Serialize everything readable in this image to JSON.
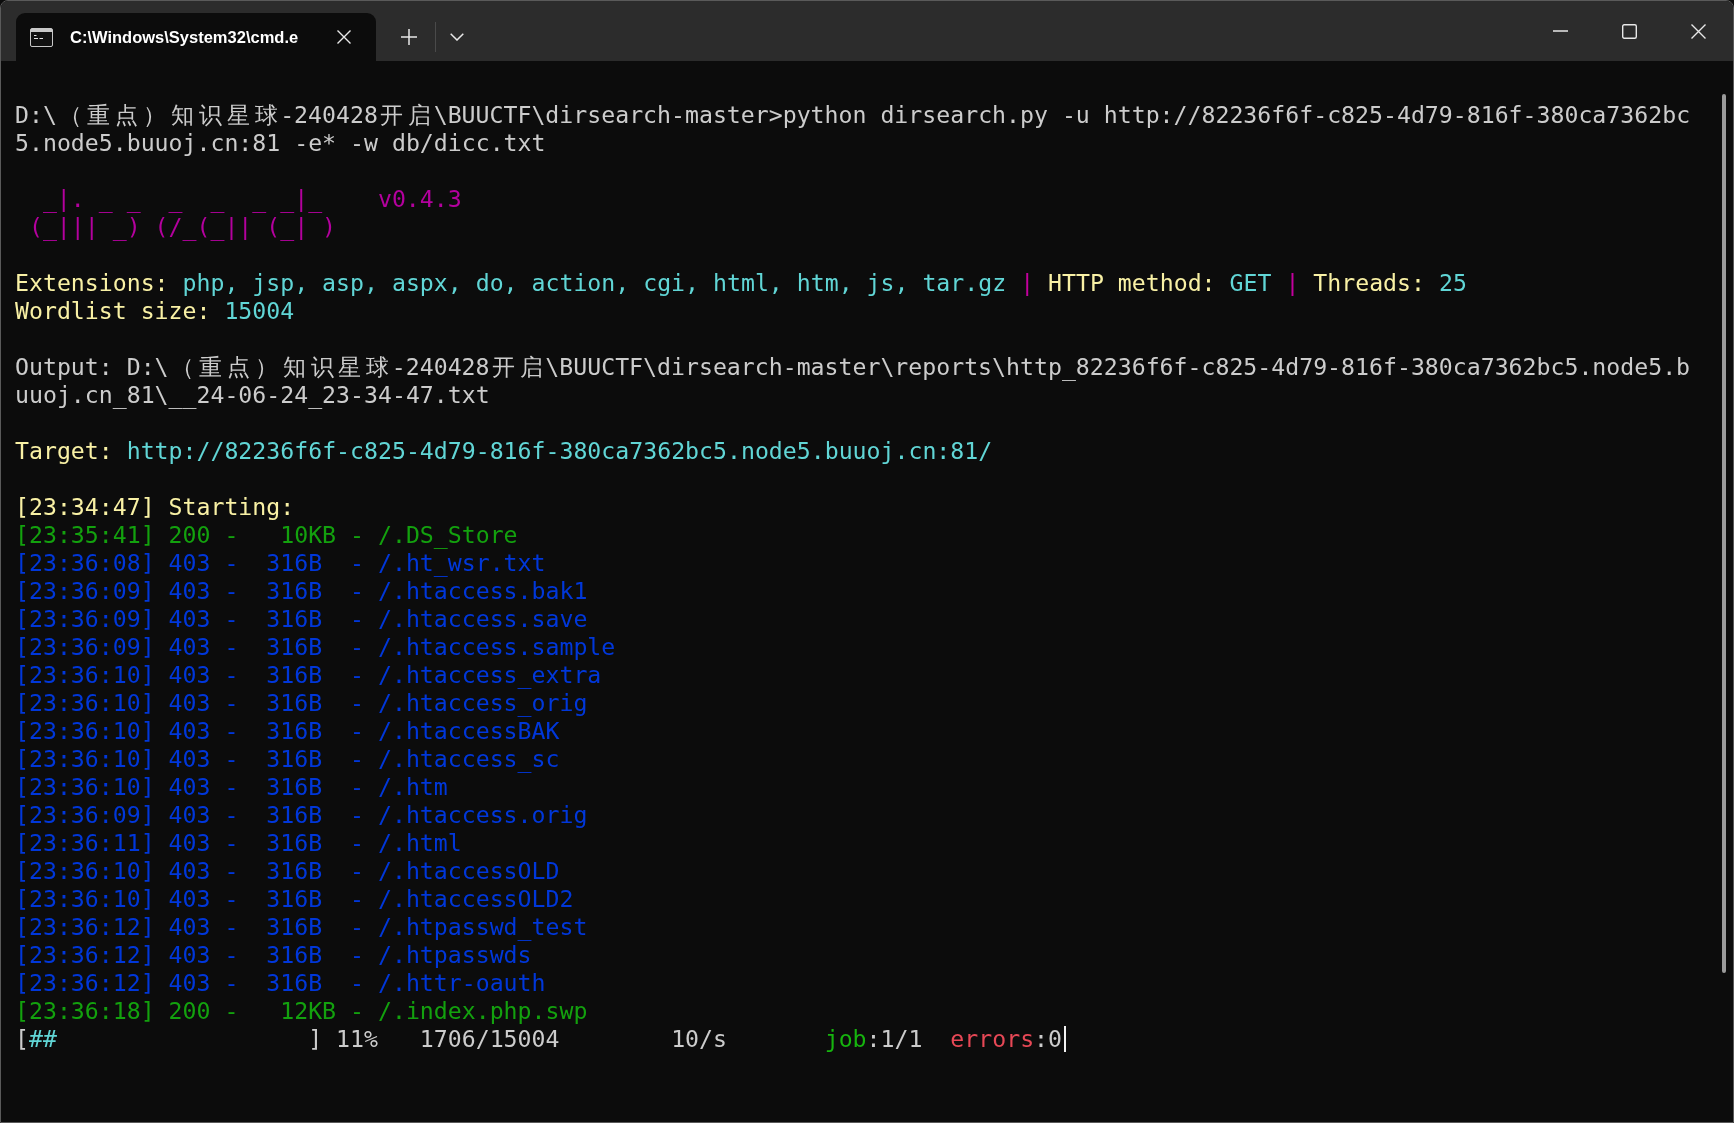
{
  "tabs": [
    {
      "title": "C:\\Windows\\System32\\cmd.e",
      "selected": true
    }
  ],
  "terminal": {
    "sections": [
      {
        "lines": [
          {
            "kind": "text",
            "text": "D:\\（重点）知识星球-240428开启\\BUUCTF\\dirsearch-master>python dirsearch.py -u http://82236f6f-c825-4d79-816f-380ca7362bc"
          },
          {
            "kind": "text",
            "text": "5.node5.buuoj.cn:81 -e* -w db/dicc.txt"
          }
        ]
      },
      {
        "lines": [
          {
            "kind": "banner",
            "art": [
              " _|. _ _  _  _  _ _|_",
              "(_||| _) (/_(_|| (_| )"
            ],
            "version": "v0.4.3"
          }
        ]
      },
      {
        "lines": [
          {
            "kind": "fields",
            "fields": [
              {
                "label": "Extensions:",
                "value": "php, jsp, asp, aspx, do, action, cgi, html, htm, js, tar.gz"
              },
              {
                "separator": "|",
                "label": "HTTP method:",
                "value": "GET"
              },
              {
                "separator": "|",
                "label": "Threads:",
                "value": "25"
              }
            ]
          },
          {
            "kind": "fields",
            "fields": [
              {
                "label": "Wordlist size:",
                "value": "15004"
              }
            ]
          }
        ]
      },
      {
        "lines": [
          {
            "kind": "text",
            "text": "Output: D:\\（重点）知识星球-240428开启\\BUUCTF\\dirsearch-master\\reports\\http_82236f6f-c825-4d79-816f-380ca7362bc5.node5.b"
          },
          {
            "kind": "text",
            "text": "uuoj.cn_81\\__24-06-24_23-34-47.txt"
          }
        ]
      },
      {
        "lines": [
          {
            "kind": "fields",
            "fields": [
              {
                "label": "Target:",
                "value": "http://82236f6f-c825-4d79-816f-380ca7362bc5.node5.buuoj.cn:81/"
              }
            ]
          }
        ]
      },
      {
        "lines": [
          {
            "kind": "status",
            "text": "[23:34:47] Starting:"
          },
          {
            "kind": "log",
            "text": "[23:35:41] 200 -   10KB - /.DS_Store",
            "color": "#13a10e"
          },
          {
            "kind": "log",
            "text": "[23:36:08] 403 -  316B  - /.ht_wsr.txt",
            "color": "#0037da"
          },
          {
            "kind": "log",
            "text": "[23:36:09] 403 -  316B  - /.htaccess.bak1",
            "color": "#0037da"
          },
          {
            "kind": "log",
            "text": "[23:36:09] 403 -  316B  - /.htaccess.save",
            "color": "#0037da"
          },
          {
            "kind": "log",
            "text": "[23:36:09] 403 -  316B  - /.htaccess.sample",
            "color": "#0037da"
          },
          {
            "kind": "log",
            "text": "[23:36:10] 403 -  316B  - /.htaccess_extra",
            "color": "#0037da"
          },
          {
            "kind": "log",
            "text": "[23:36:10] 403 -  316B  - /.htaccess_orig",
            "color": "#0037da"
          },
          {
            "kind": "log",
            "text": "[23:36:10] 403 -  316B  - /.htaccessBAK",
            "color": "#0037da"
          },
          {
            "kind": "log",
            "text": "[23:36:10] 403 -  316B  - /.htaccess_sc",
            "color": "#0037da"
          },
          {
            "kind": "log",
            "text": "[23:36:10] 403 -  316B  - /.htm",
            "color": "#0037da"
          },
          {
            "kind": "log",
            "text": "[23:36:09] 403 -  316B  - /.htaccess.orig",
            "color": "#0037da"
          },
          {
            "kind": "log",
            "text": "[23:36:11] 403 -  316B  - /.html",
            "color": "#0037da"
          },
          {
            "kind": "log",
            "text": "[23:36:10] 403 -  316B  - /.htaccessOLD",
            "color": "#0037da"
          },
          {
            "kind": "log",
            "text": "[23:36:10] 403 -  316B  - /.htaccessOLD2",
            "color": "#0037da"
          },
          {
            "kind": "log",
            "text": "[23:36:12] 403 -  316B  - /.htpasswd_test",
            "color": "#0037da"
          },
          {
            "kind": "log",
            "text": "[23:36:12] 403 -  316B  - /.htpasswds",
            "color": "#0037da"
          },
          {
            "kind": "log",
            "text": "[23:36:12] 403 -  316B  - /.httr-oauth",
            "color": "#0037da"
          },
          {
            "kind": "log",
            "text": "[23:36:18] 200 -   12KB - /.index.php.swp",
            "color": "#13a10e"
          },
          {
            "kind": "progress",
            "open": "[",
            "fill": "##",
            "close": "]",
            "percent": "11%",
            "count": "1706/15004",
            "rate": "10/s",
            "job_label": "job",
            "job": ":1/1",
            "errors_label": "errors",
            "errors": ":0"
          }
        ]
      }
    ]
  }
}
